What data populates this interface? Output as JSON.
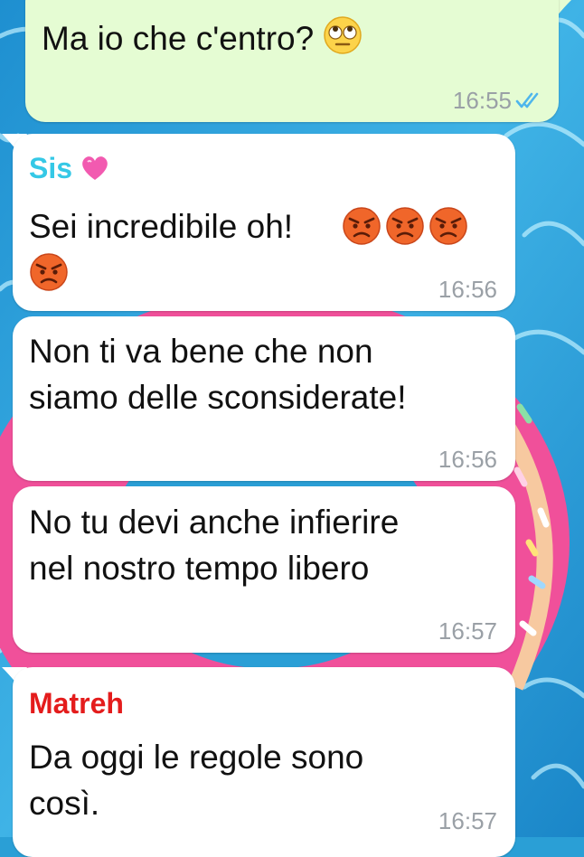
{
  "messages": [
    {
      "text": "Ma io che c'entro?",
      "emoji": [
        "rolling-eyes"
      ],
      "time": "16:55",
      "status": "read"
    },
    {
      "sender": "Sis",
      "sender_emoji": "pink-heart",
      "sender_color": "#35c8e6",
      "text": "Sei incredibile oh!",
      "emoji": [
        "angry",
        "angry",
        "angry",
        "angry"
      ],
      "time": "16:56"
    },
    {
      "text_lines": [
        "Non ti va bene che non",
        "siamo delle sconsiderate!"
      ],
      "time": "16:56"
    },
    {
      "text_lines": [
        "No tu devi anche infierire",
        "nel nostro tempo libero"
      ],
      "time": "16:57"
    },
    {
      "sender": "Matreh",
      "sender_color": "#e41c1c",
      "text_lines": [
        "Da oggi le regole sono",
        "così."
      ],
      "time": "16:57"
    }
  ],
  "colors": {
    "incoming_bubble": "#ffffff",
    "outgoing_bubble": "#e5fcd3",
    "read_ticks": "#4fb6ec",
    "timestamp": "#9aa0a6"
  }
}
